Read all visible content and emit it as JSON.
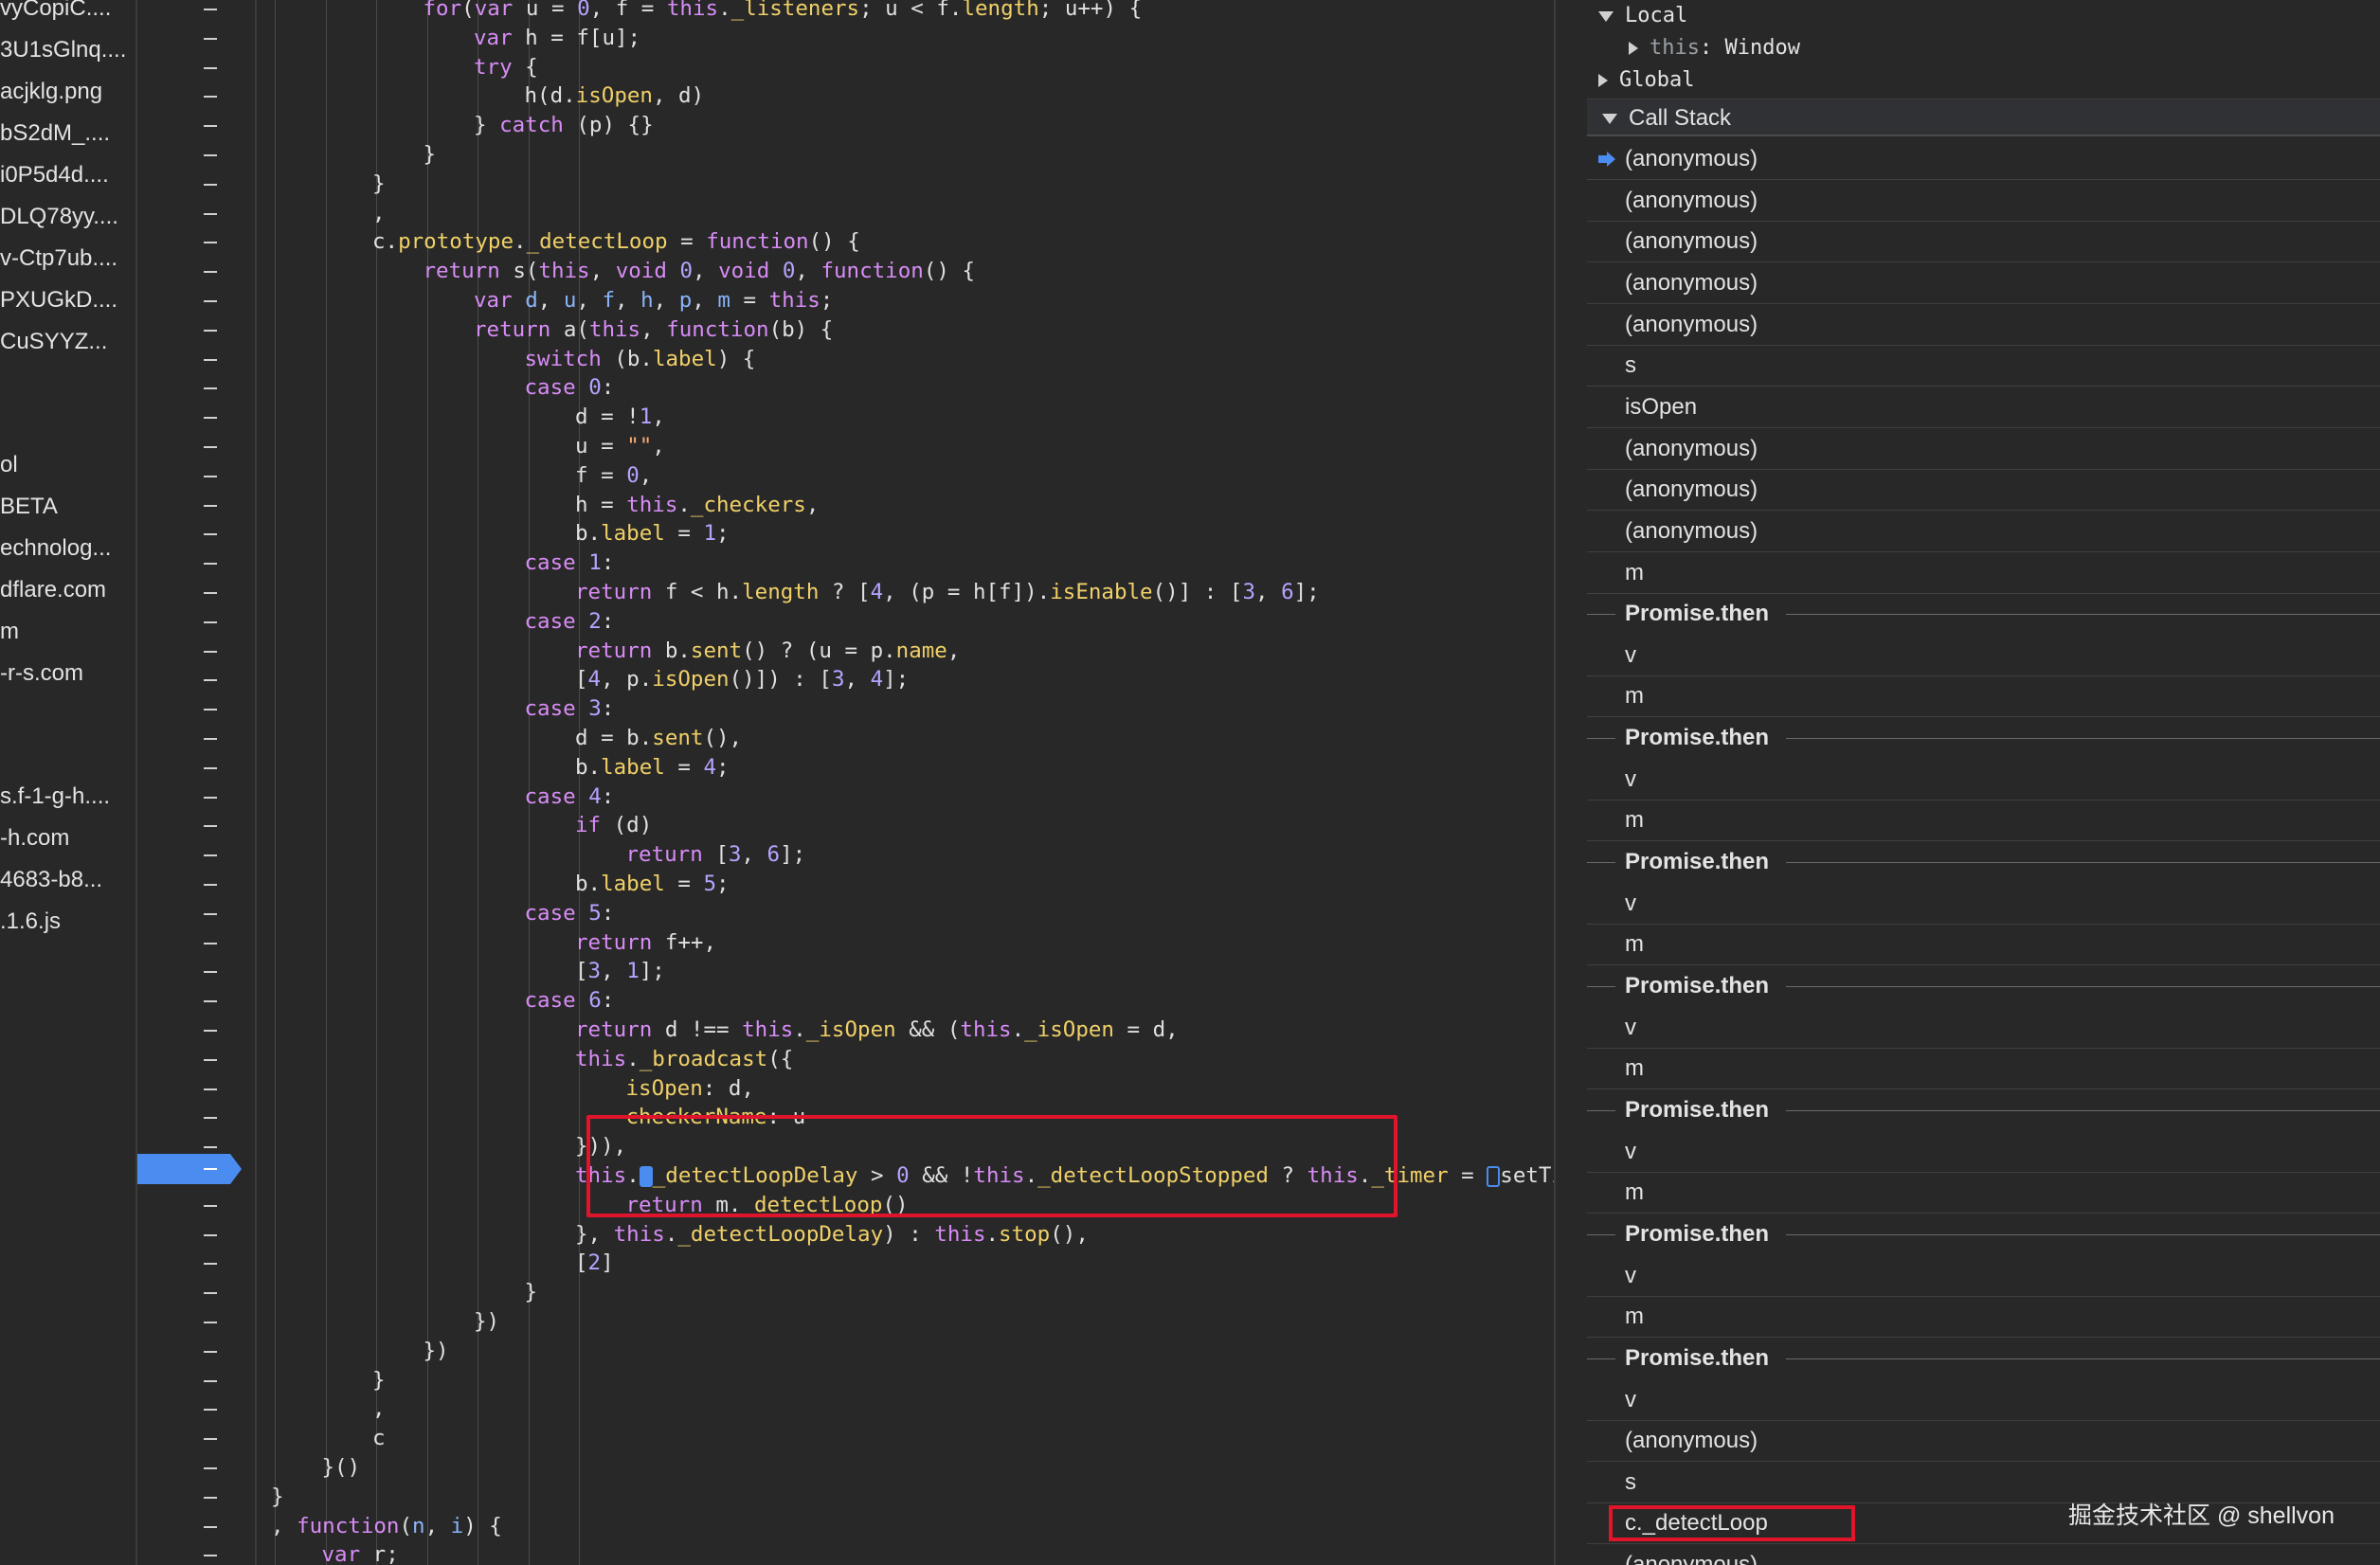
{
  "file_tree": [
    "vyCopiC....",
    "3U1sGlnq....",
    "acjklg.png",
    "bS2dM_....",
    "i0P5d4d....",
    "DLQ78yy....",
    "v-Ctp7ub....",
    "PXUGkD....",
    "CuSYYZ...",
    "ol",
    " BETA",
    "echnolog...",
    "dflare.com",
    "m",
    "-r-s.com",
    "s.f-1-g-h....",
    "-h.com",
    "4683-b8...",
    ".1.6.js"
  ],
  "code_lines": [
    {
      "i": 3,
      "t": [
        [
          "kw",
          "for"
        ],
        [
          "",
          "("
        ],
        [
          "kw",
          "var"
        ],
        [
          "",
          " u = "
        ],
        [
          "num",
          "0"
        ],
        [
          "",
          ", f = "
        ],
        [
          "kw",
          "this"
        ],
        [
          "",
          "."
        ],
        [
          "fn",
          "_listeners"
        ],
        [
          "",
          "; u < f."
        ],
        [
          "fn",
          "length"
        ],
        [
          "",
          "; u++) {"
        ]
      ]
    },
    {
      "i": 4,
      "t": [
        [
          "kw",
          "var"
        ],
        [
          "",
          " h = f[u];"
        ]
      ]
    },
    {
      "i": 4,
      "t": [
        [
          "kw",
          "try"
        ],
        [
          "",
          " {"
        ]
      ]
    },
    {
      "i": 5,
      "t": [
        [
          "",
          "h(d."
        ],
        [
          "fn",
          "isOpen"
        ],
        [
          "",
          ", d)"
        ]
      ]
    },
    {
      "i": 4,
      "t": [
        [
          "",
          "} "
        ],
        [
          "kw",
          "catch"
        ],
        [
          "",
          " (p) {}"
        ]
      ]
    },
    {
      "i": 3,
      "t": [
        [
          "",
          "}"
        ]
      ]
    },
    {
      "i": 2,
      "t": [
        [
          "",
          "}"
        ]
      ]
    },
    {
      "i": 2,
      "t": [
        [
          "",
          ","
        ]
      ]
    },
    {
      "i": 2,
      "t": [
        [
          "",
          "c."
        ],
        [
          "fn",
          "prototype"
        ],
        [
          "",
          "."
        ],
        [
          "fn",
          "_detectLoop"
        ],
        [
          "",
          " = "
        ],
        [
          "kw",
          "function"
        ],
        [
          "",
          "() {"
        ]
      ]
    },
    {
      "i": 3,
      "t": [
        [
          "kw",
          "return"
        ],
        [
          "",
          " s("
        ],
        [
          "kw",
          "this"
        ],
        [
          "",
          ", "
        ],
        [
          "kw",
          "void"
        ],
        [
          "",
          " "
        ],
        [
          "num",
          "0"
        ],
        [
          "",
          ", "
        ],
        [
          "kw",
          "void"
        ],
        [
          "",
          " "
        ],
        [
          "num",
          "0"
        ],
        [
          "",
          ", "
        ],
        [
          "kw",
          "function"
        ],
        [
          "",
          "() {"
        ]
      ]
    },
    {
      "i": 4,
      "t": [
        [
          "kw",
          "var"
        ],
        [
          "",
          " "
        ],
        [
          "prm",
          "d"
        ],
        [
          "",
          ", "
        ],
        [
          "prm",
          "u"
        ],
        [
          "",
          ", "
        ],
        [
          "prm",
          "f"
        ],
        [
          "",
          ", "
        ],
        [
          "prm",
          "h"
        ],
        [
          "",
          ", "
        ],
        [
          "prm",
          "p"
        ],
        [
          "",
          ", "
        ],
        [
          "prm",
          "m"
        ],
        [
          "",
          " = "
        ],
        [
          "kw",
          "this"
        ],
        [
          "",
          ";"
        ]
      ]
    },
    {
      "i": 4,
      "t": [
        [
          "kw",
          "return"
        ],
        [
          "",
          " a("
        ],
        [
          "kw",
          "this"
        ],
        [
          "",
          ", "
        ],
        [
          "kw",
          "function"
        ],
        [
          "",
          "(b) {"
        ]
      ]
    },
    {
      "i": 5,
      "t": [
        [
          "kw",
          "switch"
        ],
        [
          "",
          " (b."
        ],
        [
          "fn",
          "label"
        ],
        [
          "",
          ") {"
        ]
      ]
    },
    {
      "i": 5,
      "t": [
        [
          "kw",
          "case"
        ],
        [
          "",
          " "
        ],
        [
          "num",
          "0"
        ],
        [
          "",
          ":"
        ]
      ]
    },
    {
      "i": 6,
      "t": [
        [
          "",
          "d = !"
        ],
        [
          "num",
          "1"
        ],
        [
          "",
          ","
        ]
      ]
    },
    {
      "i": 6,
      "t": [
        [
          "",
          "u = "
        ],
        [
          "str",
          "\"\""
        ],
        [
          "",
          ","
        ]
      ]
    },
    {
      "i": 6,
      "t": [
        [
          "",
          "f = "
        ],
        [
          "num",
          "0"
        ],
        [
          "",
          ","
        ]
      ]
    },
    {
      "i": 6,
      "t": [
        [
          "",
          "h = "
        ],
        [
          "kw",
          "this"
        ],
        [
          "",
          "."
        ],
        [
          "fn",
          "_checkers"
        ],
        [
          "",
          ","
        ]
      ]
    },
    {
      "i": 6,
      "t": [
        [
          "",
          "b."
        ],
        [
          "fn",
          "label"
        ],
        [
          "",
          " = "
        ],
        [
          "num",
          "1"
        ],
        [
          "",
          ";"
        ]
      ]
    },
    {
      "i": 5,
      "t": [
        [
          "kw",
          "case"
        ],
        [
          "",
          " "
        ],
        [
          "num",
          "1"
        ],
        [
          "",
          ":"
        ]
      ]
    },
    {
      "i": 6,
      "t": [
        [
          "kw",
          "return"
        ],
        [
          "",
          " f < h."
        ],
        [
          "fn",
          "length"
        ],
        [
          "",
          " ? ["
        ],
        [
          "num",
          "4"
        ],
        [
          "",
          ", (p = h[f])."
        ],
        [
          "fn",
          "isEnable"
        ],
        [
          "",
          "()] : ["
        ],
        [
          "num",
          "3"
        ],
        [
          "",
          ", "
        ],
        [
          "num",
          "6"
        ],
        [
          "",
          "];"
        ]
      ]
    },
    {
      "i": 5,
      "t": [
        [
          "kw",
          "case"
        ],
        [
          "",
          " "
        ],
        [
          "num",
          "2"
        ],
        [
          "",
          ":"
        ]
      ]
    },
    {
      "i": 6,
      "t": [
        [
          "kw",
          "return"
        ],
        [
          "",
          " b."
        ],
        [
          "fn",
          "sent"
        ],
        [
          "",
          "() ? (u = p."
        ],
        [
          "fn",
          "name"
        ],
        [
          "",
          ","
        ]
      ]
    },
    {
      "i": 6,
      "t": [
        [
          "",
          "["
        ],
        [
          "num",
          "4"
        ],
        [
          "",
          ", p."
        ],
        [
          "fn",
          "isOpen"
        ],
        [
          "",
          "()]) : ["
        ],
        [
          "num",
          "3"
        ],
        [
          "",
          ", "
        ],
        [
          "num",
          "4"
        ],
        [
          "",
          "];"
        ]
      ]
    },
    {
      "i": 5,
      "t": [
        [
          "kw",
          "case"
        ],
        [
          "",
          " "
        ],
        [
          "num",
          "3"
        ],
        [
          "",
          ":"
        ]
      ]
    },
    {
      "i": 6,
      "t": [
        [
          "",
          "d = b."
        ],
        [
          "fn",
          "sent"
        ],
        [
          "",
          "(),"
        ]
      ]
    },
    {
      "i": 6,
      "t": [
        [
          "",
          "b."
        ],
        [
          "fn",
          "label"
        ],
        [
          "",
          " = "
        ],
        [
          "num",
          "4"
        ],
        [
          "",
          ";"
        ]
      ]
    },
    {
      "i": 5,
      "t": [
        [
          "kw",
          "case"
        ],
        [
          "",
          " "
        ],
        [
          "num",
          "4"
        ],
        [
          "",
          ":"
        ]
      ]
    },
    {
      "i": 6,
      "t": [
        [
          "kw",
          "if"
        ],
        [
          "",
          " (d)"
        ]
      ]
    },
    {
      "i": 7,
      "t": [
        [
          "kw",
          "return"
        ],
        [
          "",
          " ["
        ],
        [
          "num",
          "3"
        ],
        [
          "",
          ", "
        ],
        [
          "num",
          "6"
        ],
        [
          "",
          "];"
        ]
      ]
    },
    {
      "i": 6,
      "t": [
        [
          "",
          "b."
        ],
        [
          "fn",
          "label"
        ],
        [
          "",
          " = "
        ],
        [
          "num",
          "5"
        ],
        [
          "",
          ";"
        ]
      ]
    },
    {
      "i": 5,
      "t": [
        [
          "kw",
          "case"
        ],
        [
          "",
          " "
        ],
        [
          "num",
          "5"
        ],
        [
          "",
          ":"
        ]
      ]
    },
    {
      "i": 6,
      "t": [
        [
          "kw",
          "return"
        ],
        [
          "",
          " f++,"
        ]
      ]
    },
    {
      "i": 6,
      "t": [
        [
          "",
          "["
        ],
        [
          "num",
          "3"
        ],
        [
          "",
          ", "
        ],
        [
          "num",
          "1"
        ],
        [
          "",
          "];"
        ]
      ]
    },
    {
      "i": 5,
      "t": [
        [
          "kw",
          "case"
        ],
        [
          "",
          " "
        ],
        [
          "num",
          "6"
        ],
        [
          "",
          ":"
        ]
      ]
    },
    {
      "i": 6,
      "t": [
        [
          "kw",
          "return"
        ],
        [
          "",
          " d !== "
        ],
        [
          "kw",
          "this"
        ],
        [
          "",
          "."
        ],
        [
          "fn",
          "_isOpen"
        ],
        [
          "",
          " && ("
        ],
        [
          "kw",
          "this"
        ],
        [
          "",
          "."
        ],
        [
          "fn",
          "_isOpen"
        ],
        [
          "",
          " = d,"
        ]
      ]
    },
    {
      "i": 6,
      "t": [
        [
          "kw",
          "this"
        ],
        [
          "",
          "."
        ],
        [
          "fn",
          "_broadcast"
        ],
        [
          "",
          "({"
        ]
      ]
    },
    {
      "i": 7,
      "t": [
        [
          "fn",
          "isOpen"
        ],
        [
          "",
          ": d,"
        ]
      ]
    },
    {
      "i": 7,
      "t": [
        [
          "fn",
          "checkerName"
        ],
        [
          "",
          ": u"
        ]
      ]
    },
    {
      "i": 6,
      "t": [
        [
          "",
          "})),"
        ]
      ]
    },
    {
      "i": 6,
      "t": [
        [
          "kw",
          "this"
        ],
        [
          "",
          "."
        ],
        [
          "mark",
          ""
        ],
        [
          "fn",
          "_detectLoopDelay"
        ],
        [
          "",
          " > "
        ],
        [
          "num",
          "0"
        ],
        [
          "",
          " && !"
        ],
        [
          "kw",
          "this"
        ],
        [
          "",
          "."
        ],
        [
          "fn",
          "_detectLoopStopped"
        ],
        [
          "",
          " ? "
        ],
        [
          "kw",
          "this"
        ],
        [
          "",
          "."
        ],
        [
          "fn",
          "_timer"
        ],
        [
          "",
          " = "
        ],
        [
          "markh",
          ""
        ],
        [
          "",
          "setTimeout"
        ]
      ]
    },
    {
      "i": 7,
      "t": [
        [
          "kw",
          "return"
        ],
        [
          "",
          " m."
        ],
        [
          "fn",
          "_detectLoop"
        ],
        [
          "",
          "()"
        ]
      ]
    },
    {
      "i": 6,
      "t": [
        [
          "",
          "}, "
        ],
        [
          "kw",
          "this"
        ],
        [
          "",
          "."
        ],
        [
          "fn",
          "_detectLoopDelay"
        ],
        [
          "",
          ") : "
        ],
        [
          "kw",
          "this"
        ],
        [
          "",
          "."
        ],
        [
          "fn",
          "stop"
        ],
        [
          "",
          "(),"
        ]
      ]
    },
    {
      "i": 6,
      "t": [
        [
          "",
          "["
        ],
        [
          "num",
          "2"
        ],
        [
          "",
          "]"
        ]
      ]
    },
    {
      "i": 5,
      "t": [
        [
          "",
          "}"
        ]
      ]
    },
    {
      "i": 4,
      "t": [
        [
          "",
          "})"
        ]
      ]
    },
    {
      "i": 3,
      "t": [
        [
          "",
          "})"
        ]
      ]
    },
    {
      "i": 2,
      "t": [
        [
          "",
          "}"
        ]
      ]
    },
    {
      "i": 2,
      "t": [
        [
          "",
          ","
        ]
      ]
    },
    {
      "i": 2,
      "t": [
        [
          "",
          "c"
        ]
      ]
    },
    {
      "i": 1,
      "t": [
        [
          "",
          "}()"
        ]
      ]
    },
    {
      "i": 0,
      "t": [
        [
          "",
          "}"
        ]
      ]
    },
    {
      "i": 0,
      "t": [
        [
          "",
          ", "
        ],
        [
          "kw",
          "function"
        ],
        [
          "",
          "("
        ],
        [
          "prm",
          "n"
        ],
        [
          "",
          ", "
        ],
        [
          "prm",
          "i"
        ],
        [
          "",
          ") {"
        ]
      ]
    },
    {
      "i": 1,
      "t": [
        [
          "kw",
          "var"
        ],
        [
          "",
          " r;"
        ]
      ]
    }
  ],
  "scope": {
    "local_label": "Local",
    "this_key": "this",
    "this_value": "Window",
    "global_label": "Global"
  },
  "call_stack": {
    "header": "Call Stack",
    "frames": [
      {
        "name": "(anonymous)",
        "kind": "frame",
        "current": true
      },
      {
        "name": "(anonymous)",
        "kind": "frame"
      },
      {
        "name": "(anonymous)",
        "kind": "frame"
      },
      {
        "name": "(anonymous)",
        "kind": "frame"
      },
      {
        "name": "(anonymous)",
        "kind": "frame"
      },
      {
        "name": "s",
        "kind": "frame"
      },
      {
        "name": "isOpen",
        "kind": "frame"
      },
      {
        "name": "(anonymous)",
        "kind": "frame"
      },
      {
        "name": "(anonymous)",
        "kind": "frame"
      },
      {
        "name": "(anonymous)",
        "kind": "frame"
      },
      {
        "name": "m",
        "kind": "frame"
      },
      {
        "name": "Promise.then",
        "kind": "async"
      },
      {
        "name": "v",
        "kind": "frame"
      },
      {
        "name": "m",
        "kind": "frame"
      },
      {
        "name": "Promise.then",
        "kind": "async"
      },
      {
        "name": "v",
        "kind": "frame"
      },
      {
        "name": "m",
        "kind": "frame"
      },
      {
        "name": "Promise.then",
        "kind": "async"
      },
      {
        "name": "v",
        "kind": "frame"
      },
      {
        "name": "m",
        "kind": "frame"
      },
      {
        "name": "Promise.then",
        "kind": "async"
      },
      {
        "name": "v",
        "kind": "frame"
      },
      {
        "name": "m",
        "kind": "frame"
      },
      {
        "name": "Promise.then",
        "kind": "async"
      },
      {
        "name": "v",
        "kind": "frame"
      },
      {
        "name": "m",
        "kind": "frame"
      },
      {
        "name": "Promise.then",
        "kind": "async"
      },
      {
        "name": "v",
        "kind": "frame"
      },
      {
        "name": "m",
        "kind": "frame"
      },
      {
        "name": "Promise.then",
        "kind": "async"
      },
      {
        "name": "v",
        "kind": "frame"
      },
      {
        "name": "(anonymous)",
        "kind": "frame"
      },
      {
        "name": "s",
        "kind": "frame"
      },
      {
        "name": "c._detectLoop",
        "kind": "frame"
      },
      {
        "name": "(anonymous)",
        "kind": "frame"
      }
    ]
  },
  "watermark": "掘金技术社区 @ shellvon",
  "colors": {
    "accent": "#4b8cf0",
    "highlight_box": "#e0142a"
  }
}
